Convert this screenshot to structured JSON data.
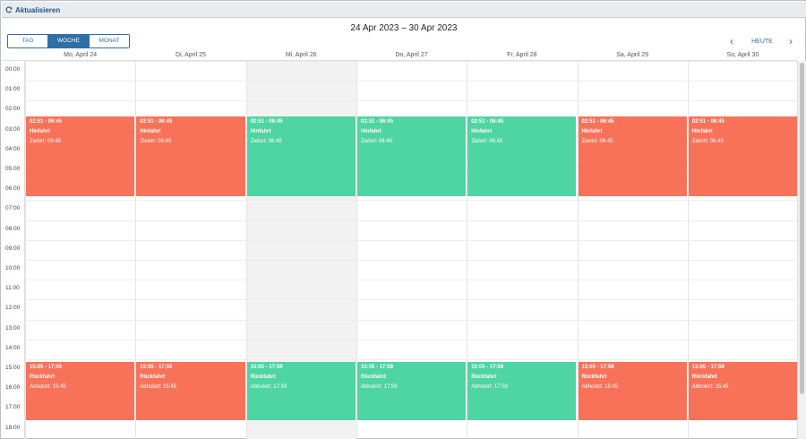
{
  "toolbar": {
    "refresh_label": "Aktualisieren"
  },
  "header": {
    "title": "24 Apr 2023 – 30 Apr 2023",
    "views": [
      {
        "label": "TAG",
        "active": false
      },
      {
        "label": "WOCHE",
        "active": true
      },
      {
        "label": "MONAT",
        "active": false
      }
    ],
    "prev_label": "‹",
    "today_label": "HEUTE",
    "next_label": "›"
  },
  "days": [
    "Mo, April 24",
    "Di, April 25",
    "Mi, April 26",
    "Do, April 27",
    "Fr, April 28",
    "Sa, April 29",
    "So, April 30"
  ],
  "today_index": 2,
  "hours": [
    "00:00",
    "01:00",
    "02:00",
    "03:00",
    "04:00",
    "05:00",
    "06:00",
    "07:00",
    "08:00",
    "09:00",
    "10:00",
    "11:00",
    "12:00",
    "13:00",
    "14:00",
    "15:00",
    "16:00",
    "17:00",
    "18:00"
  ],
  "colors": {
    "red": "#f87259",
    "green": "#4fd4a3",
    "accent": "#2f6ea6"
  },
  "events": [
    {
      "day": 0,
      "time": "02:51 - 06:45",
      "name": "Hinfahrt",
      "detail": "Zielort: 06:45",
      "color": "red",
      "slot": "morning"
    },
    {
      "day": 1,
      "time": "02:51 - 06:45",
      "name": "Hinfahrt",
      "detail": "Zielort: 06:45",
      "color": "red",
      "slot": "morning"
    },
    {
      "day": 2,
      "time": "02:51 - 06:45",
      "name": "Hinfahrt",
      "detail": "Zielort: 06:45",
      "color": "green",
      "slot": "morning"
    },
    {
      "day": 3,
      "time": "02:51 - 06:45",
      "name": "Hinfahrt",
      "detail": "Zielort: 06:45",
      "color": "green",
      "slot": "morning"
    },
    {
      "day": 4,
      "time": "02:51 - 06:45",
      "name": "Hinfahrt",
      "detail": "Zielort: 06:45",
      "color": "green",
      "slot": "morning"
    },
    {
      "day": 5,
      "time": "02:51 - 06:45",
      "name": "Hinfahrt",
      "detail": "Zielort: 06:45",
      "color": "red",
      "slot": "morning"
    },
    {
      "day": 6,
      "time": "02:51 - 06:45",
      "name": "Hinfahrt",
      "detail": "Zielort: 06:45",
      "color": "red",
      "slot": "morning"
    },
    {
      "day": 0,
      "time": "15:05 - 17:59",
      "name": "Rückfahrt",
      "detail": "Abholort: 15:45",
      "color": "red",
      "slot": "afternoon"
    },
    {
      "day": 1,
      "time": "15:05 - 17:59",
      "name": "Rückfahrt",
      "detail": "Abholort: 15:45",
      "color": "red",
      "slot": "afternoon"
    },
    {
      "day": 2,
      "time": "15:05 - 17:59",
      "name": "Rückfahrt",
      "detail": "Abholort: 17:59",
      "color": "green",
      "slot": "afternoon"
    },
    {
      "day": 3,
      "time": "15:05 - 17:59",
      "name": "Rückfahrt",
      "detail": "Abholort: 17:59",
      "color": "green",
      "slot": "afternoon"
    },
    {
      "day": 4,
      "time": "15:05 - 17:59",
      "name": "Rückfahrt",
      "detail": "Abholort: 17:59",
      "color": "green",
      "slot": "afternoon"
    },
    {
      "day": 5,
      "time": "15:05 - 17:59",
      "name": "Rückfahrt",
      "detail": "Abholort: 15:45",
      "color": "red",
      "slot": "afternoon"
    },
    {
      "day": 6,
      "time": "15:05 - 17:59",
      "name": "Rückfahrt",
      "detail": "Abholort: 15:45",
      "color": "red",
      "slot": "afternoon"
    }
  ]
}
